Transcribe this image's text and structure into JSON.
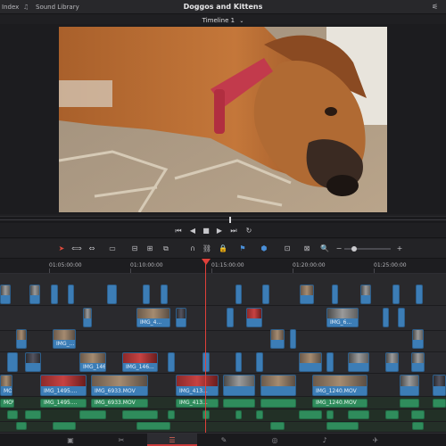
{
  "topbar": {
    "left_label": "Index",
    "sound_library_label": "Sound Library",
    "project_title": "Doggos and Kittens",
    "timeline_name": "Timeline 1",
    "timeline_dropdown_icon": "chevron-down-icon"
  },
  "viewer": {
    "content": "dog photo frame"
  },
  "transport": {
    "buttons": [
      "skip-to-start",
      "step-back",
      "stop",
      "play",
      "skip-to-end",
      "loop"
    ]
  },
  "ruler": {
    "timecodes": [
      "01:05:00:00",
      "01:10:00:00",
      "01:15:00:00",
      "01:20:00:00",
      "01:25:00:00"
    ]
  },
  "clips": {
    "c1": "IMG_4...",
    "c2": "IMG_6...",
    "c3": "IMG_...",
    "c4": "IMG_146...",
    "c5": "IMG_146...",
    "c6": "IMG_1495....",
    "c7": "IMG_6933.MOV",
    "c8": "IMG_413...",
    "c9": "IMG_1240.MOV",
    "c10": "MOV",
    "c11": "IMG_1495....",
    "c12": "IMG_6933.MOV",
    "c13": "IMG_413...",
    "c14": "IMG_1240.MOV"
  },
  "colors": {
    "playhead": "#e0403a",
    "video_clip": "#3c7db6",
    "audio_clip": "#2f8c5c"
  },
  "pagebar": {
    "pages": [
      "media",
      "cut",
      "edit",
      "fusion",
      "color",
      "fairlight",
      "deliver"
    ],
    "active": "edit"
  }
}
